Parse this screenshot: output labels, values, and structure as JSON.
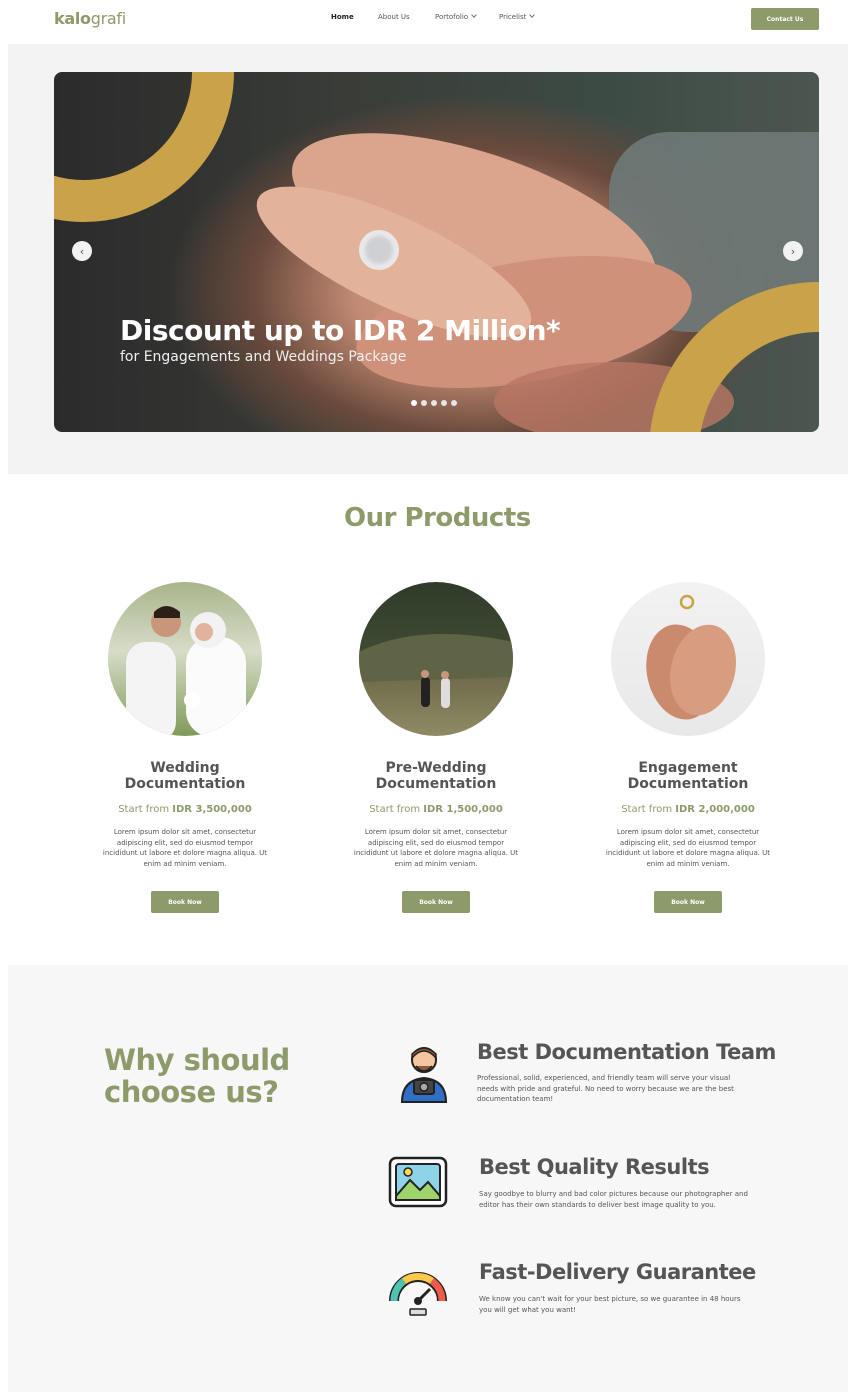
{
  "nav": {
    "logo_bold": "kalo",
    "logo_rest": "grafi",
    "links": [
      "Home",
      "About Us",
      "Portofolio",
      "Pricelist"
    ],
    "contact": "Contact Us"
  },
  "hero": {
    "title": "Discount up to IDR 2 Million*",
    "subtitle": "for Engagements and Weddings Package",
    "prev_icon": "chevron-left-icon",
    "next_icon": "chevron-right-icon",
    "slides": 5,
    "active_slide": 1
  },
  "products": {
    "title": "Our Products",
    "items": [
      {
        "name_line1": "Wedding",
        "name_line2": "Documentation",
        "price_prefix": "Start from",
        "price": "IDR 3,500,000",
        "desc": "Lorem ipsum dolor sit amet, consectetur adipiscing elit, sed do eiusmod tempor incididunt ut labore et dolore magna aliqua. Ut enim ad minim veniam.",
        "button": "Book Now"
      },
      {
        "name_line1": "Pre-Wedding",
        "name_line2": "Documentation",
        "price_prefix": "Start from",
        "price": "IDR 1,500,000",
        "desc": "Lorem ipsum dolor sit amet, consectetur adipiscing elit, sed do eiusmod tempor incididunt ut labore et dolore magna aliqua. Ut enim ad minim veniam.",
        "button": "Book Now"
      },
      {
        "name_line1": "Engagement",
        "name_line2": "Documentation",
        "price_prefix": "Start from",
        "price": "IDR 2,000,000",
        "desc": "Lorem ipsum dolor sit amet, consectetur adipiscing elit, sed do eiusmod tempor incididunt ut labore et dolore magna aliqua. Ut enim ad minim veniam.",
        "button": "Book Now"
      }
    ]
  },
  "why": {
    "title_line1": "Why should",
    "title_line2": "choose us?",
    "features": [
      {
        "icon": "photographer-icon",
        "title": "Best Documentation Team",
        "desc": "Professional, solid, experienced, and friendly team will serve your visual needs with pride and grateful. No need to worry because we are the best documentation team!"
      },
      {
        "icon": "picture-frame-icon",
        "title": "Best Quality Results",
        "desc": "Say goodbye to blurry and bad color pictures because our photographer and editor has their own standards to deliver best image quality to you."
      },
      {
        "icon": "speedometer-icon",
        "title": "Fast-Delivery Guarantee",
        "desc": "We know you can't wait for your best picture, so we guarantee in 48 hours you will get what you want!"
      }
    ]
  },
  "colors": {
    "accent": "#8d9a6a",
    "gold": "#c9a24a"
  }
}
